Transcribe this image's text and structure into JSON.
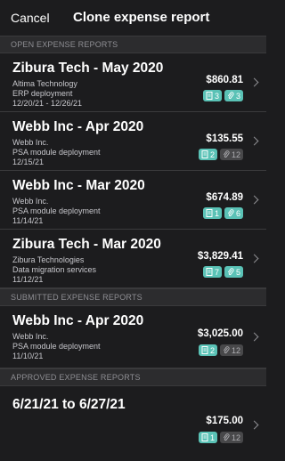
{
  "nav": {
    "cancel_label": "Cancel",
    "title": "Clone expense report"
  },
  "sections": {
    "open": "OPEN EXPENSE REPORTS",
    "submitted": "SUBMITTED EXPENSE REPORTS",
    "approved": "APPROVED EXPENSE REPORTS"
  },
  "reports": [
    {
      "title": "Zibura Tech - May 2020",
      "line1": "Altima Technology",
      "line2": "ERP deployment",
      "line3": "12/20/21 - 12/26/21",
      "amount": "$860.81",
      "receipts": "3",
      "attachments": "3",
      "receipts_active": true,
      "attachments_active": true
    },
    {
      "title": "Webb Inc - Apr 2020",
      "line1": "Webb Inc.",
      "line2": "PSA module deployment",
      "line3": "12/15/21",
      "amount": "$135.55",
      "receipts": "2",
      "attachments": "12",
      "receipts_active": true,
      "attachments_active": false
    },
    {
      "title": "Webb Inc - Mar 2020",
      "line1": "Webb Inc.",
      "line2": "PSA module deployment",
      "line3": "11/14/21",
      "amount": "$674.89",
      "receipts": "1",
      "attachments": "6",
      "receipts_active": true,
      "attachments_active": true
    },
    {
      "title": "Zibura Tech - Mar 2020",
      "line1": "Zibura Technologies",
      "line2": "Data migration services",
      "line3": "11/12/21",
      "amount": "$3,829.41",
      "receipts": "7",
      "attachments": "5",
      "receipts_active": true,
      "attachments_active": true
    },
    {
      "title": "Webb Inc - Apr 2020",
      "line1": "Webb Inc.",
      "line2": "PSA module deployment",
      "line3": "11/10/21",
      "amount": "$3,025.00",
      "receipts": "2",
      "attachments": "12",
      "receipts_active": true,
      "attachments_active": false
    },
    {
      "title": "6/21/21 to 6/27/21",
      "amount": "$175.00",
      "receipts": "1",
      "attachments": "12",
      "receipts_active": true,
      "attachments_active": false
    }
  ],
  "colors": {
    "background": "#1c1c1e",
    "section_bg": "#2c2c2e",
    "badge_active": "#5ac2b6",
    "badge_inactive": "#48484a"
  },
  "icons": {
    "receipt": "receipt-icon",
    "attachment": "paperclip-icon",
    "chevron": "chevron-right-icon"
  }
}
